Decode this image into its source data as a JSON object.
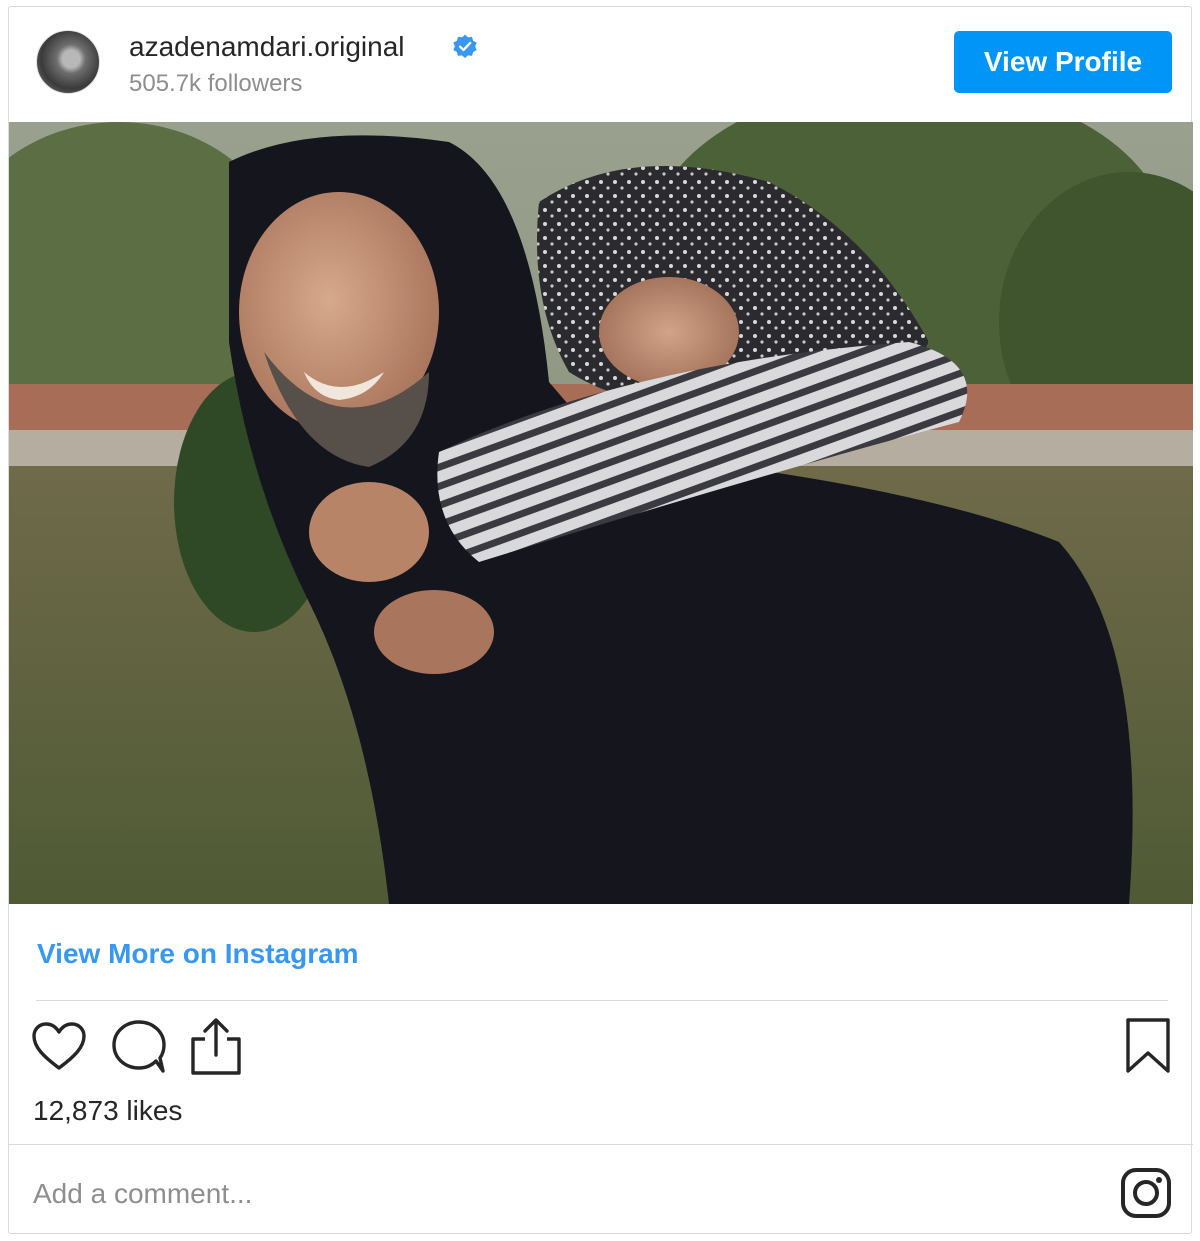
{
  "header": {
    "username": "azadenamdari.original",
    "verified": true,
    "followers": "505.7k followers",
    "view_profile_label": "View Profile"
  },
  "post": {
    "photo_alt": "azadenamdari.original post photo",
    "view_more_label": "View More on Instagram",
    "likes": "12,873 likes"
  },
  "actions": {
    "icons": [
      "heart-icon",
      "comment-icon",
      "share-icon",
      "bookmark-icon"
    ]
  },
  "comment": {
    "placeholder": "Add a comment..."
  },
  "footer": {
    "logo_icon": "instagram-icon"
  },
  "colors": {
    "accent": "#0095f6",
    "link": "#3897f0",
    "verified": "#3897f0",
    "text": "#262626",
    "muted": "#8e8e8e",
    "border": "#dbdbdb"
  }
}
